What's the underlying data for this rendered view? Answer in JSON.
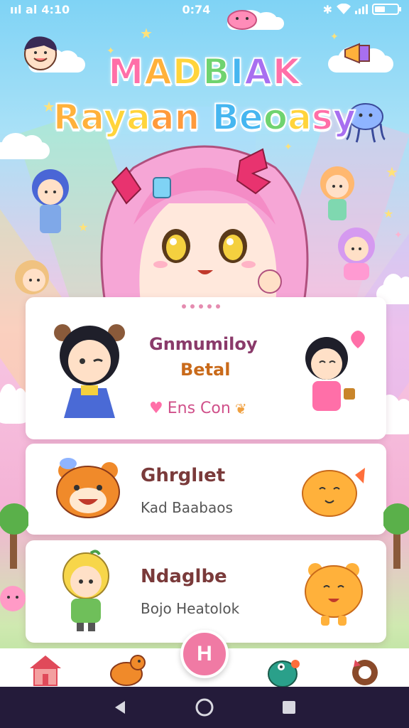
{
  "status_bar": {
    "left_text": "ııl al",
    "left_time": "4:10",
    "center_time": "0:74"
  },
  "title": {
    "line1_letters": [
      "M",
      "A",
      "D",
      "B",
      "I",
      "A",
      "K"
    ],
    "line1_colors": [
      "#ff6fa8",
      "#ffb13b",
      "#ffd43b",
      "#6fd36f",
      "#46b6f0",
      "#a86ff0",
      "#ff6fa8"
    ],
    "line2_letters": [
      "R",
      "a",
      "y",
      "a",
      "a",
      "n",
      " ",
      "B",
      "e",
      "o",
      "a",
      "s",
      "y"
    ],
    "line2_colors": [
      "#ffb13b",
      "#ffb13b",
      "#ffd43b",
      "#ffd43b",
      "#ff9a3b",
      "#ff9a3b",
      "#ffffff",
      "#46b6f0",
      "#46b6f0",
      "#6fd36f",
      "#ffd43b",
      "#ff6fa8",
      "#a86ff0"
    ]
  },
  "cards": [
    {
      "title_line1": "Gnmumiloy",
      "title_line2": "Betal",
      "subtitle": "Ens Con",
      "left_icon": "bear-girl-character-icon",
      "right_icon": "girl-with-heart-icon"
    },
    {
      "title": "Ghrglıet",
      "subtitle": "Kad Baabaos",
      "left_icon": "orange-bear-icon",
      "right_icon": "orange-cat-icon"
    },
    {
      "title": "Ndaglbe",
      "subtitle": "Bojo Heatolok",
      "left_icon": "blonde-boy-icon",
      "right_icon": "orange-bear-waving-icon"
    }
  ],
  "bottom_nav": {
    "fab_label": "H",
    "items": [
      "home-icon",
      "dino-icon",
      "bird-icon",
      "puppy-icon"
    ]
  },
  "colors": {
    "accent": "#f07aa4",
    "card_title": "#7a3a3a",
    "sys_nav": "#241b3a"
  }
}
